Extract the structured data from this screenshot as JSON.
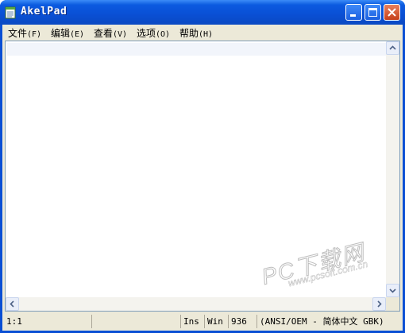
{
  "window": {
    "title": "AkelPad"
  },
  "menu": [
    {
      "label": "文件",
      "accel": "(F)"
    },
    {
      "label": "编辑",
      "accel": "(E)"
    },
    {
      "label": "查看",
      "accel": "(V)"
    },
    {
      "label": "选项",
      "accel": "(O)"
    },
    {
      "label": "帮助",
      "accel": "(H)"
    }
  ],
  "editor": {
    "content": ""
  },
  "status": {
    "position": "1:1",
    "insert_mode": "Ins",
    "newline": "Win",
    "codepage": "936",
    "encoding": "(ANSI/OEM - 简体中文 GBK)"
  },
  "watermark": {
    "main": "PC下载网",
    "sub": "www.pcsoft.com.cn"
  },
  "colors": {
    "titlebar": "#0a4fd4",
    "frame": "#ece9d8",
    "close": "#c6401a"
  },
  "icons": [
    "notepad-icon",
    "minimize-icon",
    "maximize-icon",
    "close-icon",
    "arrow-up-icon",
    "arrow-down-icon",
    "arrow-left-icon",
    "arrow-right-icon"
  ]
}
